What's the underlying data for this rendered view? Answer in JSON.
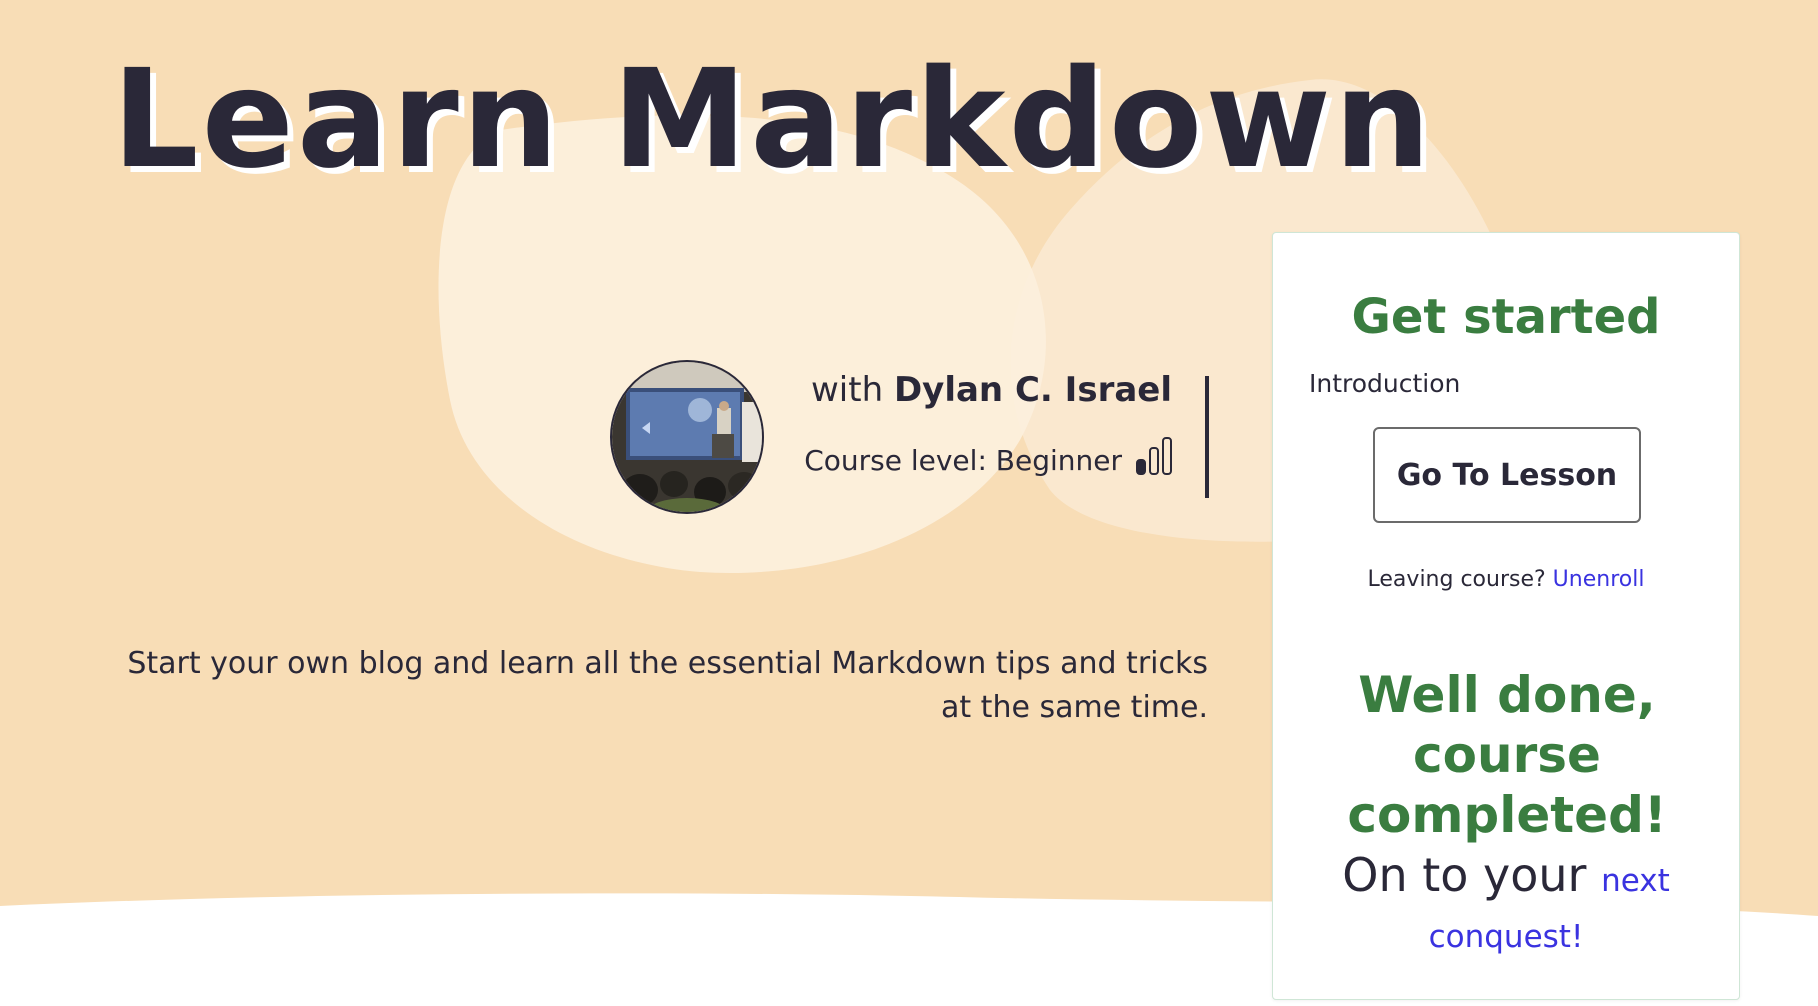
{
  "course": {
    "title": "Learn Markdown",
    "author_prefix": "with",
    "author_name": "Dylan C. Israel",
    "level_text": "Course level: Beginner",
    "level_value": 1,
    "level_max": 3,
    "description": "Start your own blog and learn all the essential Markdown tips and tricks at the same time."
  },
  "card": {
    "title": "Get started",
    "lesson_name": "Introduction",
    "go_button": "Go To Lesson",
    "leaving_text": "Leaving course?",
    "unenroll_link": "Unenroll",
    "completed_title": "Well done, course completed!",
    "onward_text": "On to your",
    "next_link_part1": "next",
    "next_link_part2": "conquest!"
  },
  "colors": {
    "hero_background": "#f8ddb6",
    "heading_dark": "#2a2838",
    "accent_green": "#3a7d40",
    "link_blue": "#3a33e0"
  },
  "icons": {
    "level": "signal-bars-icon",
    "avatar": "instructor-photo"
  }
}
